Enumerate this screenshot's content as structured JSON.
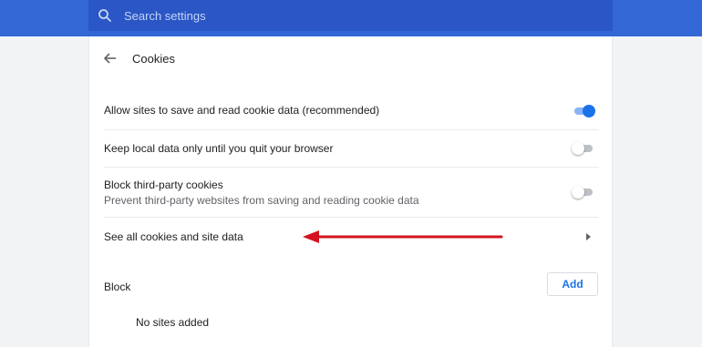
{
  "search": {
    "placeholder": "Search settings"
  },
  "header": {
    "title": "Cookies"
  },
  "settings": [
    {
      "label": "Allow sites to save and read cookie data (recommended)",
      "toggle": "on"
    },
    {
      "label": "Keep local data only until you quit your browser",
      "toggle": "off"
    },
    {
      "label": "Block third-party cookies",
      "sublabel": "Prevent third-party websites from saving and reading cookie data",
      "toggle": "off"
    },
    {
      "label": "See all cookies and site data"
    }
  ],
  "block": {
    "label": "Block",
    "add_label": "Add",
    "empty_text": "No sites added"
  },
  "colors": {
    "topbar": "#3367d6",
    "search_box": "#2a56c6",
    "accent": "#1a73e8",
    "annotation_arrow": "#d3131f"
  }
}
